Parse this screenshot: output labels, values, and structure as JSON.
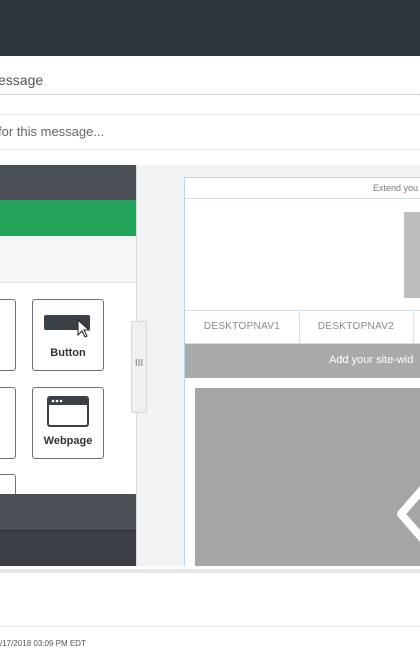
{
  "message": {
    "title_text": "essage",
    "description_placeholder": "for this message..."
  },
  "palette": {
    "tiles": [
      {
        "label": "Button",
        "icon": "button-icon"
      },
      {
        "label": "Webpage",
        "icon": "webpage-icon"
      }
    ]
  },
  "resize_handle": "III",
  "preview": {
    "extend_text": "Extend you",
    "nav_items": [
      "DESKTOPNAV1",
      "DESKTOPNAV2"
    ],
    "banner_text": "Add your site-wid"
  },
  "footer": {
    "timestamp": "/17/2018 03:09 PM EDT"
  }
}
